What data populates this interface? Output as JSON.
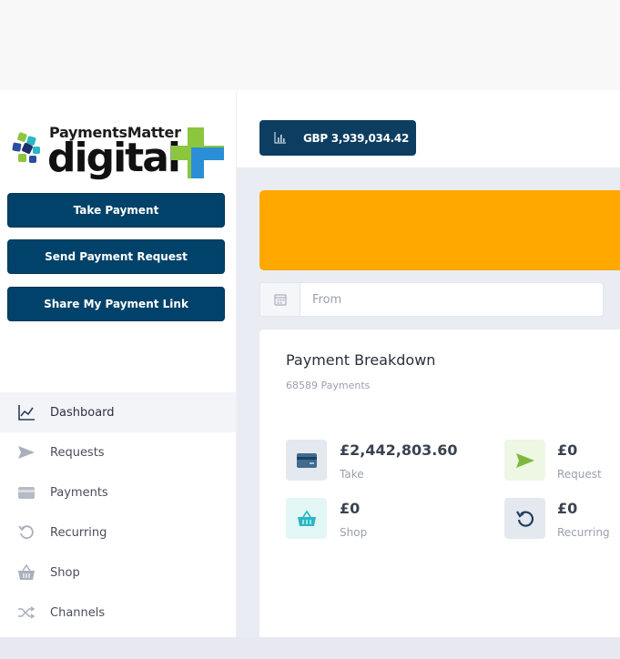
{
  "brand": {
    "logo_top": "PaymentsMatter",
    "logo_main": "digital"
  },
  "sidebar": {
    "buttons": [
      "Take Payment",
      "Send Payment Request",
      "Share My Payment Link"
    ],
    "nav": [
      {
        "label": "Dashboard",
        "icon": "chart-line-icon",
        "active": true
      },
      {
        "label": "Requests",
        "icon": "send-icon"
      },
      {
        "label": "Payments",
        "icon": "card-icon"
      },
      {
        "label": "Recurring",
        "icon": "recurring-icon"
      },
      {
        "label": "Shop",
        "icon": "basket-icon"
      },
      {
        "label": "Channels",
        "icon": "shuffle-icon"
      }
    ]
  },
  "header": {
    "balance": "GBP 3,939,034.42"
  },
  "filters": {
    "from_placeholder": "From"
  },
  "breakdown": {
    "title": "Payment Breakdown",
    "count": "68589 Payments",
    "stats": [
      {
        "value": "£2,442,803.60",
        "label": "Take",
        "icon": "card-icon",
        "color": "#e4e8ef"
      },
      {
        "value": "£0",
        "label": "Request",
        "icon": "send-icon",
        "color": "#eef6e4"
      },
      {
        "value": "£0",
        "label": "Shop",
        "icon": "basket-icon",
        "color": "#e2f6f6"
      },
      {
        "value": "£0",
        "label": "Recurring",
        "icon": "recurring-icon",
        "color": "#e4e8ef"
      }
    ]
  },
  "colors": {
    "primary": "#01426a",
    "banner": "#ffa800",
    "accent_green": "#8cc63f",
    "accent_teal": "#2ab7c3"
  }
}
